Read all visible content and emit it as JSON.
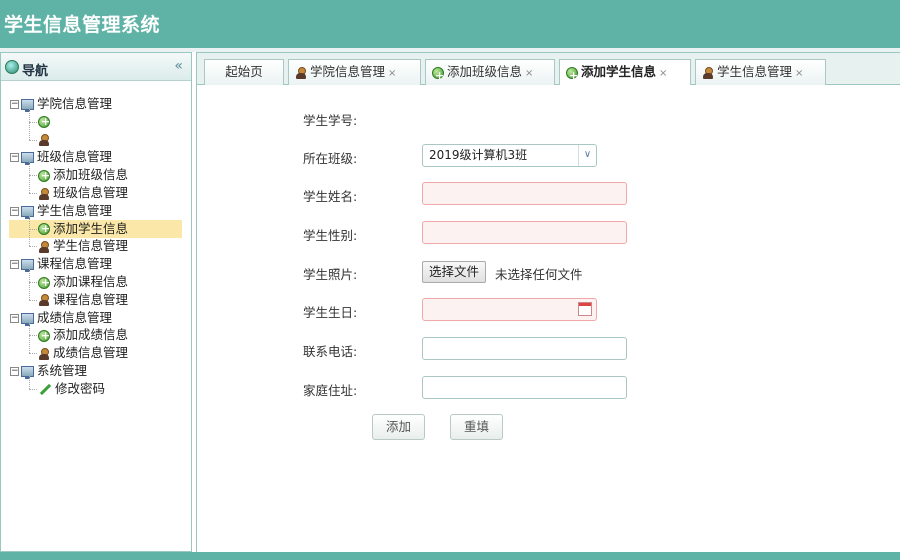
{
  "header": {
    "title": "学生信息管理系统"
  },
  "sidebar": {
    "title": "导航",
    "collapse_glyph": "«",
    "tree": [
      {
        "label": "学院信息管理",
        "children": [
          {
            "label": "",
            "icon": "add-icon"
          },
          {
            "label": "",
            "icon": "user-icon"
          }
        ]
      },
      {
        "label": "班级信息管理",
        "children": [
          {
            "label": "添加班级信息",
            "icon": "add-icon"
          },
          {
            "label": "班级信息管理",
            "icon": "user-icon"
          }
        ]
      },
      {
        "label": "学生信息管理",
        "children": [
          {
            "label": "添加学生信息",
            "icon": "add-icon",
            "selected": true
          },
          {
            "label": "学生信息管理",
            "icon": "user-icon"
          }
        ]
      },
      {
        "label": "课程信息管理",
        "children": [
          {
            "label": "添加课程信息",
            "icon": "add-icon"
          },
          {
            "label": "课程信息管理",
            "icon": "user-icon"
          }
        ]
      },
      {
        "label": "成绩信息管理",
        "children": [
          {
            "label": "添加成绩信息",
            "icon": "add-icon"
          },
          {
            "label": "成绩信息管理",
            "icon": "user-icon"
          }
        ]
      },
      {
        "label": "系统管理",
        "children": [
          {
            "label": "修改密码",
            "icon": "pencil-icon"
          }
        ]
      }
    ]
  },
  "tabs": [
    {
      "label": "起始页",
      "icon": "",
      "closable": false,
      "active": false
    },
    {
      "label": "学院信息管理",
      "icon": "user-icon",
      "closable": true,
      "active": false
    },
    {
      "label": "添加班级信息",
      "icon": "add-icon",
      "closable": true,
      "active": false
    },
    {
      "label": "添加学生信息",
      "icon": "add-icon",
      "closable": true,
      "active": true
    },
    {
      "label": "学生信息管理",
      "icon": "user-icon",
      "closable": true,
      "active": false
    }
  ],
  "tab_close_glyph": "×",
  "form": {
    "student_no_label": "学生学号:",
    "class_label": "所在班级:",
    "class_value": "2019级计算机3班",
    "name_label": "学生姓名:",
    "gender_label": "学生性别:",
    "photo_label": "学生照片:",
    "photo_button": "选择文件",
    "photo_note": "未选择任何文件",
    "birthday_label": "学生生日:",
    "phone_label": "联系电话:",
    "address_label": "家庭住址:",
    "submit_label": "添加",
    "reset_label": "重填"
  },
  "colors": {
    "header_bg": "#5fb3a6",
    "selected_row": "#fbe8a8",
    "required_border": "#f0a8a8"
  }
}
